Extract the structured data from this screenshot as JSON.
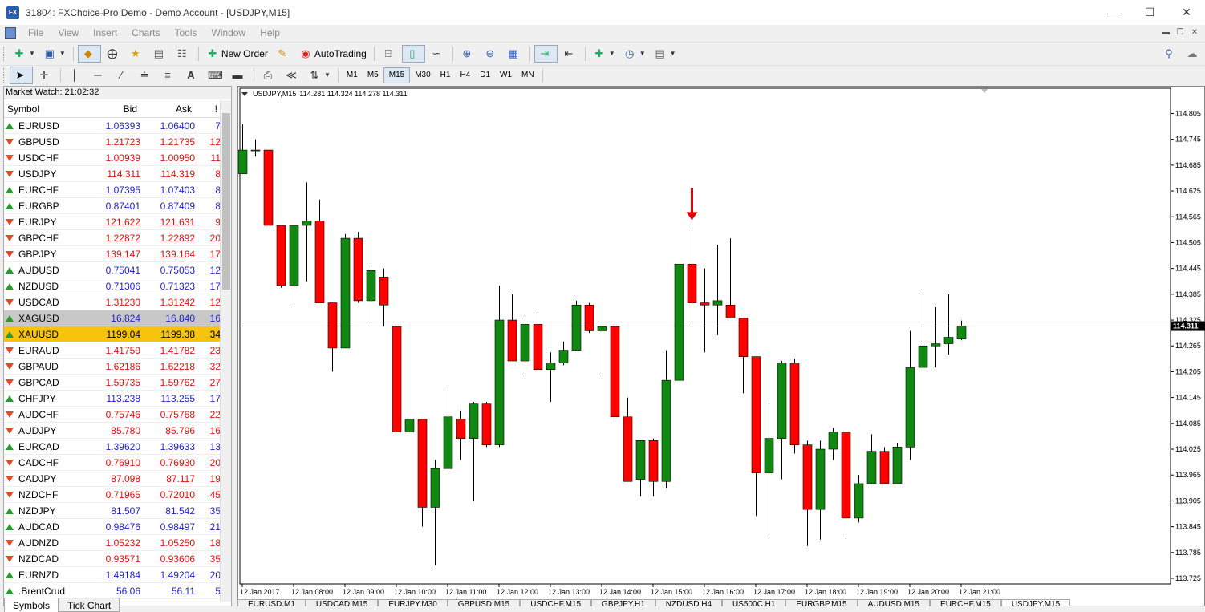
{
  "window": {
    "title": "31804: FXChoice-Pro Demo - Demo Account - [USDJPY,M15]",
    "logo_text": "FX"
  },
  "menu": [
    "File",
    "View",
    "Insert",
    "Charts",
    "Tools",
    "Window",
    "Help"
  ],
  "toolbar": {
    "new_order": "New Order",
    "autotrading": "AutoTrading",
    "timeframes": [
      "M1",
      "M5",
      "M15",
      "M30",
      "H1",
      "H4",
      "D1",
      "W1",
      "MN"
    ],
    "active_timeframe": "M15"
  },
  "market_watch": {
    "title": "Market Watch: 21:02:32",
    "columns": [
      "Symbol",
      "Bid",
      "Ask",
      "!"
    ],
    "rows": [
      {
        "symbol": "EURUSD",
        "bid": "1.06393",
        "ask": "1.06400",
        "spread": "7",
        "dir": "up",
        "color": "blue"
      },
      {
        "symbol": "GBPUSD",
        "bid": "1.21723",
        "ask": "1.21735",
        "spread": "12",
        "dir": "down",
        "color": "red"
      },
      {
        "symbol": "USDCHF",
        "bid": "1.00939",
        "ask": "1.00950",
        "spread": "11",
        "dir": "down",
        "color": "red"
      },
      {
        "symbol": "USDJPY",
        "bid": "114.311",
        "ask": "114.319",
        "spread": "8",
        "dir": "down",
        "color": "red"
      },
      {
        "symbol": "EURCHF",
        "bid": "1.07395",
        "ask": "1.07403",
        "spread": "8",
        "dir": "up",
        "color": "blue"
      },
      {
        "symbol": "EURGBP",
        "bid": "0.87401",
        "ask": "0.87409",
        "spread": "8",
        "dir": "up",
        "color": "blue"
      },
      {
        "symbol": "EURJPY",
        "bid": "121.622",
        "ask": "121.631",
        "spread": "9",
        "dir": "down",
        "color": "red"
      },
      {
        "symbol": "GBPCHF",
        "bid": "1.22872",
        "ask": "1.22892",
        "spread": "20",
        "dir": "down",
        "color": "red"
      },
      {
        "symbol": "GBPJPY",
        "bid": "139.147",
        "ask": "139.164",
        "spread": "17",
        "dir": "down",
        "color": "red"
      },
      {
        "symbol": "AUDUSD",
        "bid": "0.75041",
        "ask": "0.75053",
        "spread": "12",
        "dir": "up",
        "color": "blue"
      },
      {
        "symbol": "NZDUSD",
        "bid": "0.71306",
        "ask": "0.71323",
        "spread": "17",
        "dir": "up",
        "color": "blue"
      },
      {
        "symbol": "USDCAD",
        "bid": "1.31230",
        "ask": "1.31242",
        "spread": "12",
        "dir": "down",
        "color": "red"
      },
      {
        "symbol": "XAGUSD",
        "bid": "16.824",
        "ask": "16.840",
        "spread": "16",
        "dir": "up",
        "color": "blue",
        "highlight": "grey"
      },
      {
        "symbol": "XAUUSD",
        "bid": "1199.04",
        "ask": "1199.38",
        "spread": "34",
        "dir": "up",
        "color": "blue",
        "highlight": "gold"
      },
      {
        "symbol": "EURAUD",
        "bid": "1.41759",
        "ask": "1.41782",
        "spread": "23",
        "dir": "down",
        "color": "red"
      },
      {
        "symbol": "GBPAUD",
        "bid": "1.62186",
        "ask": "1.62218",
        "spread": "32",
        "dir": "down",
        "color": "red"
      },
      {
        "symbol": "GBPCAD",
        "bid": "1.59735",
        "ask": "1.59762",
        "spread": "27",
        "dir": "down",
        "color": "red"
      },
      {
        "symbol": "CHFJPY",
        "bid": "113.238",
        "ask": "113.255",
        "spread": "17",
        "dir": "up",
        "color": "blue"
      },
      {
        "symbol": "AUDCHF",
        "bid": "0.75746",
        "ask": "0.75768",
        "spread": "22",
        "dir": "down",
        "color": "red"
      },
      {
        "symbol": "AUDJPY",
        "bid": "85.780",
        "ask": "85.796",
        "spread": "16",
        "dir": "down",
        "color": "red"
      },
      {
        "symbol": "EURCAD",
        "bid": "1.39620",
        "ask": "1.39633",
        "spread": "13",
        "dir": "up",
        "color": "blue"
      },
      {
        "symbol": "CADCHF",
        "bid": "0.76910",
        "ask": "0.76930",
        "spread": "20",
        "dir": "down",
        "color": "red"
      },
      {
        "symbol": "CADJPY",
        "bid": "87.098",
        "ask": "87.117",
        "spread": "19",
        "dir": "down",
        "color": "red"
      },
      {
        "symbol": "NZDCHF",
        "bid": "0.71965",
        "ask": "0.72010",
        "spread": "45",
        "dir": "down",
        "color": "red"
      },
      {
        "symbol": "NZDJPY",
        "bid": "81.507",
        "ask": "81.542",
        "spread": "35",
        "dir": "up",
        "color": "blue"
      },
      {
        "symbol": "AUDCAD",
        "bid": "0.98476",
        "ask": "0.98497",
        "spread": "21",
        "dir": "up",
        "color": "blue"
      },
      {
        "symbol": "AUDNZD",
        "bid": "1.05232",
        "ask": "1.05250",
        "spread": "18",
        "dir": "down",
        "color": "red"
      },
      {
        "symbol": "NZDCAD",
        "bid": "0.93571",
        "ask": "0.93606",
        "spread": "35",
        "dir": "down",
        "color": "red"
      },
      {
        "symbol": "EURNZD",
        "bid": "1.49184",
        "ask": "1.49204",
        "spread": "20",
        "dir": "up",
        "color": "blue"
      },
      {
        "symbol": ".BrentCrud",
        "bid": "56.06",
        "ask": "56.11",
        "spread": "5",
        "dir": "up",
        "color": "blue"
      }
    ],
    "tabs": [
      "Symbols",
      "Tick Chart"
    ]
  },
  "chart_tabs": [
    "EURUSD,M1",
    "USDCAD,M15",
    "EURJPY,M30",
    "GBPUSD,M15",
    "USDCHF,M15",
    "GBPJPY,H1",
    "NZDUSD,H4",
    "US500C,H1",
    "EURGBP,M15",
    "AUDUSD,M15",
    "EURCHF,M15",
    "USDJPY,M15"
  ],
  "chart_tabs_active": "USDJPY,M15",
  "chart_data": {
    "type": "candlestick",
    "symbol_label": "USDJPY,M15",
    "ohlc_header": "114.281 114.324 114.278 114.311",
    "current_price": 114.311,
    "current_price_label": "114.311",
    "ylim": [
      113.725,
      114.845
    ],
    "y_ticks": [
      "114.805",
      "114.745",
      "114.685",
      "114.625",
      "114.565",
      "114.505",
      "114.445",
      "114.385",
      "114.325",
      "114.265",
      "114.205",
      "114.145",
      "114.085",
      "114.025",
      "113.965",
      "113.905",
      "113.845",
      "113.785",
      "113.725"
    ],
    "x_labels": [
      {
        "i": 0,
        "text": "12 Jan 2017"
      },
      {
        "i": 4,
        "text": "12 Jan 08:00"
      },
      {
        "i": 8,
        "text": "12 Jan 09:00"
      },
      {
        "i": 12,
        "text": "12 Jan 10:00"
      },
      {
        "i": 16,
        "text": "12 Jan 11:00"
      },
      {
        "i": 20,
        "text": "12 Jan 12:00"
      },
      {
        "i": 24,
        "text": "12 Jan 13:00"
      },
      {
        "i": 28,
        "text": "12 Jan 14:00"
      },
      {
        "i": 32,
        "text": "12 Jan 15:00"
      },
      {
        "i": 36,
        "text": "12 Jan 16:00"
      },
      {
        "i": 40,
        "text": "12 Jan 17:00"
      },
      {
        "i": 44,
        "text": "12 Jan 18:00"
      },
      {
        "i": 48,
        "text": "12 Jan 19:00"
      },
      {
        "i": 52,
        "text": "12 Jan 20:00"
      },
      {
        "i": 56,
        "text": "12 Jan 21:00"
      }
    ],
    "annotation": {
      "type": "arrow-down",
      "candle_index": 35,
      "color": "#e00000"
    },
    "bull_color": "#118811",
    "bear_color": "#ff0000",
    "candles": [
      {
        "o": 114.665,
        "h": 114.78,
        "l": 114.665,
        "c": 114.72
      },
      {
        "o": 114.72,
        "h": 114.745,
        "l": 114.705,
        "c": 114.72
      },
      {
        "o": 114.72,
        "h": 114.72,
        "l": 114.545,
        "c": 114.545
      },
      {
        "o": 114.545,
        "h": 114.545,
        "l": 114.4,
        "c": 114.405
      },
      {
        "o": 114.405,
        "h": 114.545,
        "l": 114.355,
        "c": 114.545
      },
      {
        "o": 114.545,
        "h": 114.645,
        "l": 114.415,
        "c": 114.555
      },
      {
        "o": 114.555,
        "h": 114.605,
        "l": 114.365,
        "c": 114.365
      },
      {
        "o": 114.365,
        "h": 114.365,
        "l": 114.205,
        "c": 114.26
      },
      {
        "o": 114.26,
        "h": 114.525,
        "l": 114.26,
        "c": 114.515
      },
      {
        "o": 114.515,
        "h": 114.53,
        "l": 114.365,
        "c": 114.37
      },
      {
        "o": 114.37,
        "h": 114.445,
        "l": 114.31,
        "c": 114.44
      },
      {
        "o": 114.425,
        "h": 114.445,
        "l": 114.31,
        "c": 114.36
      },
      {
        "o": 114.31,
        "h": 114.31,
        "l": 114.065,
        "c": 114.065
      },
      {
        "o": 114.065,
        "h": 114.095,
        "l": 114.065,
        "c": 114.095
      },
      {
        "o": 114.095,
        "h": 114.095,
        "l": 113.845,
        "c": 113.89
      },
      {
        "o": 113.89,
        "h": 114.0,
        "l": 113.755,
        "c": 113.98
      },
      {
        "o": 113.98,
        "h": 114.16,
        "l": 113.98,
        "c": 114.1
      },
      {
        "o": 114.095,
        "h": 114.115,
        "l": 114.0,
        "c": 114.05
      },
      {
        "o": 114.05,
        "h": 114.135,
        "l": 113.905,
        "c": 114.13
      },
      {
        "o": 114.13,
        "h": 114.135,
        "l": 114.03,
        "c": 114.035
      },
      {
        "o": 114.035,
        "h": 114.405,
        "l": 114.03,
        "c": 114.325
      },
      {
        "o": 114.325,
        "h": 114.385,
        "l": 114.23,
        "c": 114.23
      },
      {
        "o": 114.23,
        "h": 114.33,
        "l": 114.2,
        "c": 114.315
      },
      {
        "o": 114.315,
        "h": 114.34,
        "l": 114.205,
        "c": 114.21
      },
      {
        "o": 114.21,
        "h": 114.25,
        "l": 114.135,
        "c": 114.225
      },
      {
        "o": 114.225,
        "h": 114.275,
        "l": 114.22,
        "c": 114.255
      },
      {
        "o": 114.255,
        "h": 114.37,
        "l": 114.255,
        "c": 114.36
      },
      {
        "o": 114.36,
        "h": 114.365,
        "l": 114.295,
        "c": 114.3
      },
      {
        "o": 114.3,
        "h": 114.31,
        "l": 114.2,
        "c": 114.31
      },
      {
        "o": 114.31,
        "h": 114.31,
        "l": 114.095,
        "c": 114.1
      },
      {
        "o": 114.1,
        "h": 114.145,
        "l": 113.95,
        "c": 113.95
      },
      {
        "o": 113.955,
        "h": 114.03,
        "l": 113.915,
        "c": 114.045
      },
      {
        "o": 114.045,
        "h": 114.05,
        "l": 113.915,
        "c": 113.95
      },
      {
        "o": 113.95,
        "h": 114.255,
        "l": 113.935,
        "c": 114.185
      },
      {
        "o": 114.185,
        "h": 114.455,
        "l": 114.185,
        "c": 114.455
      },
      {
        "o": 114.455,
        "h": 114.535,
        "l": 114.32,
        "c": 114.365
      },
      {
        "o": 114.365,
        "h": 114.445,
        "l": 114.25,
        "c": 114.36
      },
      {
        "o": 114.36,
        "h": 114.5,
        "l": 114.29,
        "c": 114.37
      },
      {
        "o": 114.36,
        "h": 114.515,
        "l": 114.335,
        "c": 114.33
      },
      {
        "o": 114.33,
        "h": 114.33,
        "l": 114.155,
        "c": 114.24
      },
      {
        "o": 114.24,
        "h": 114.24,
        "l": 113.87,
        "c": 113.97
      },
      {
        "o": 113.97,
        "h": 114.13,
        "l": 113.825,
        "c": 114.05
      },
      {
        "o": 114.05,
        "h": 114.23,
        "l": 113.955,
        "c": 114.225
      },
      {
        "o": 114.225,
        "h": 114.235,
        "l": 114.015,
        "c": 114.035
      },
      {
        "o": 114.035,
        "h": 114.045,
        "l": 113.8,
        "c": 113.885
      },
      {
        "o": 113.885,
        "h": 114.045,
        "l": 113.815,
        "c": 114.025
      },
      {
        "o": 114.025,
        "h": 114.075,
        "l": 114.0,
        "c": 114.065
      },
      {
        "o": 114.065,
        "h": 114.065,
        "l": 113.82,
        "c": 113.865
      },
      {
        "o": 113.865,
        "h": 113.965,
        "l": 113.855,
        "c": 113.945
      },
      {
        "o": 113.945,
        "h": 114.06,
        "l": 113.945,
        "c": 114.02
      },
      {
        "o": 114.02,
        "h": 114.03,
        "l": 113.945,
        "c": 113.945
      },
      {
        "o": 113.945,
        "h": 114.04,
        "l": 113.95,
        "c": 114.03
      },
      {
        "o": 114.03,
        "h": 114.3,
        "l": 114.0,
        "c": 114.215
      },
      {
        "o": 114.215,
        "h": 114.385,
        "l": 114.205,
        "c": 114.265
      },
      {
        "o": 114.265,
        "h": 114.355,
        "l": 114.215,
        "c": 114.27
      },
      {
        "o": 114.27,
        "h": 114.385,
        "l": 114.245,
        "c": 114.285
      },
      {
        "o": 114.281,
        "h": 114.324,
        "l": 114.278,
        "c": 114.311
      }
    ]
  }
}
